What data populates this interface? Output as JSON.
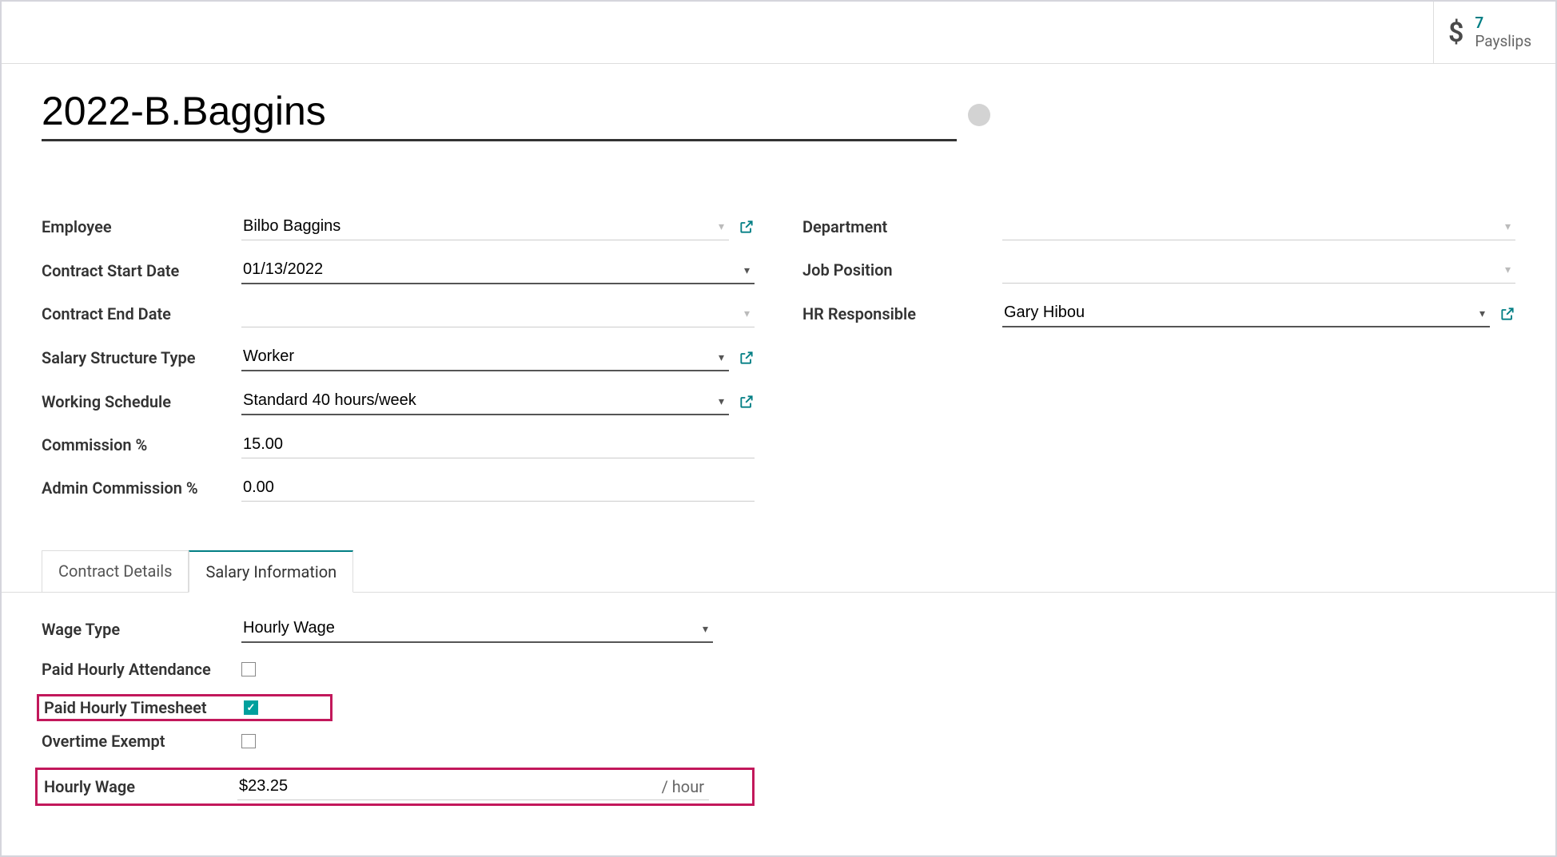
{
  "topbar": {
    "payslips_count": "7",
    "payslips_label": "Payslips"
  },
  "title": "2022-B.Baggins",
  "left_fields": {
    "employee": {
      "label": "Employee",
      "value": "Bilbo Baggins"
    },
    "contract_start": {
      "label": "Contract Start Date",
      "value": "01/13/2022"
    },
    "contract_end": {
      "label": "Contract End Date",
      "value": ""
    },
    "salary_structure": {
      "label": "Salary Structure Type",
      "value": "Worker"
    },
    "working_schedule": {
      "label": "Working Schedule",
      "value": "Standard 40 hours/week"
    },
    "commission": {
      "label": "Commission %",
      "value": "15.00"
    },
    "admin_commission": {
      "label": "Admin Commission %",
      "value": "0.00"
    }
  },
  "right_fields": {
    "department": {
      "label": "Department",
      "value": ""
    },
    "job_position": {
      "label": "Job Position",
      "value": ""
    },
    "hr_responsible": {
      "label": "HR Responsible",
      "value": "Gary Hibou"
    }
  },
  "tabs": {
    "contract_details": "Contract Details",
    "salary_information": "Salary Information"
  },
  "salary": {
    "wage_type": {
      "label": "Wage Type",
      "value": "Hourly Wage"
    },
    "paid_hourly_attendance": {
      "label": "Paid Hourly Attendance"
    },
    "paid_hourly_timesheet": {
      "label": "Paid Hourly Timesheet"
    },
    "overtime_exempt": {
      "label": "Overtime Exempt"
    },
    "hourly_wage": {
      "label": "Hourly Wage",
      "value": "$23.25",
      "suffix": "/ hour"
    }
  }
}
